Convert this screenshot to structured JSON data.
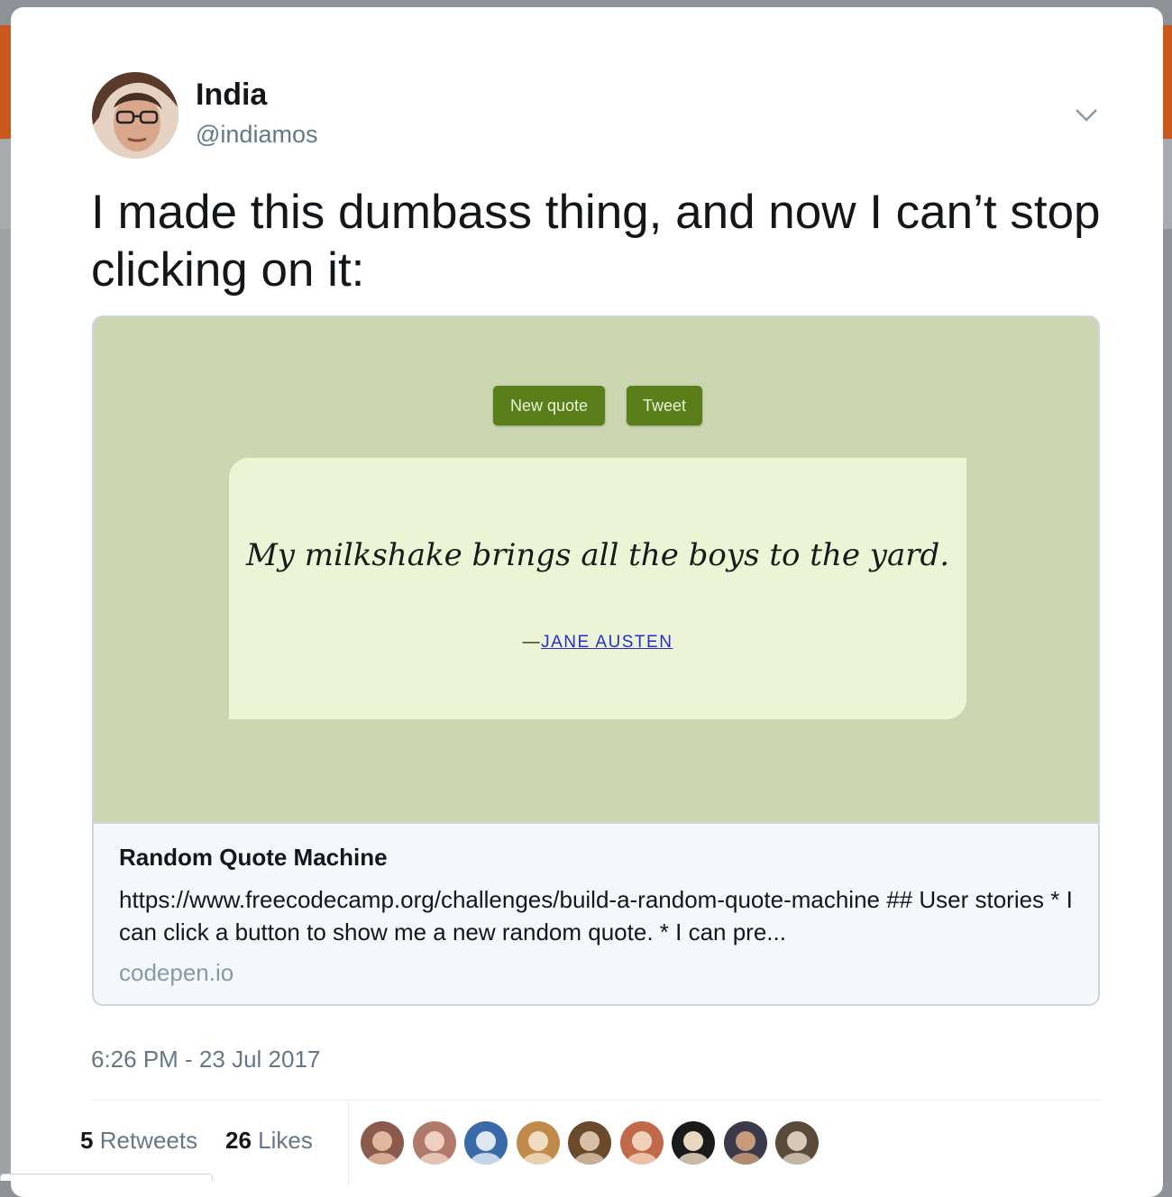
{
  "author": {
    "name": "India",
    "handle": "@indiamos"
  },
  "icons": {
    "caret": "chevron-down-icon"
  },
  "tweet": {
    "text": "I made this dumbass thing, and now I can’t stop clicking on it:",
    "timestamp": "6:26 PM - 23 Jul 2017"
  },
  "card": {
    "preview": {
      "new_quote_label": "New quote",
      "tweet_label": "Tweet",
      "quote": "My milkshake brings all the boys to the yard.",
      "author_dash": "—",
      "author": "JANE AUSTEN"
    },
    "title": "Random Quote Machine",
    "description": "https://www.freecodecamp.org/challenges/build-a-random-quote-machine ## User stories * I can click a button to show me a new random quote. * I can pre...",
    "domain": "codepen.io"
  },
  "stats": {
    "retweets_count": "5",
    "retweets_label": "Retweets",
    "likes_count": "26",
    "likes_label": "Likes"
  },
  "likers_count": 9,
  "colors": {
    "preview_bg": "#cbd6b1",
    "quote_bg": "#ebf5d5",
    "button_green": "#5a7f1a",
    "link_blue": "#2a2acd",
    "header_orange": "#c8581d"
  }
}
